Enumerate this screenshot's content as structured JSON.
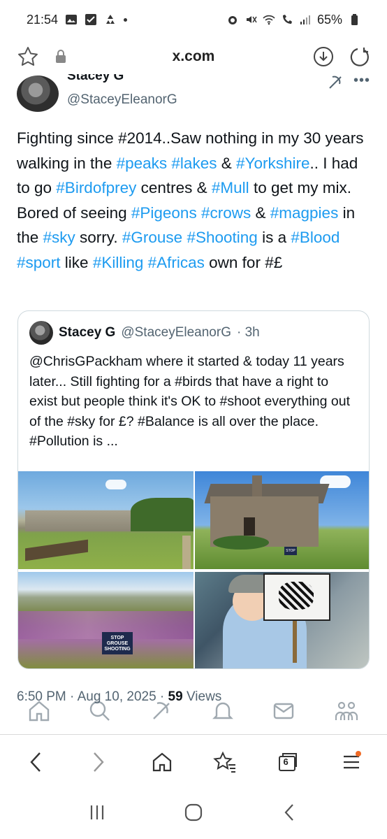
{
  "status_bar": {
    "time": "21:54",
    "battery": "65%"
  },
  "browser": {
    "url": "x.com"
  },
  "tweet": {
    "author_name": "Stacey G",
    "author_handle": "@StaceyEleanorG",
    "text_segments": [
      {
        "t": "Fighting since #2014..Saw nothing in my 30 years walking in the ",
        "tag": false
      },
      {
        "t": "#peaks",
        "tag": true
      },
      {
        "t": " ",
        "tag": false
      },
      {
        "t": "#lakes",
        "tag": true
      },
      {
        "t": " & ",
        "tag": false
      },
      {
        "t": "#Yorkshire",
        "tag": true
      },
      {
        "t": ".. I had to go ",
        "tag": false
      },
      {
        "t": "#Birdofprey",
        "tag": true
      },
      {
        "t": " centres & ",
        "tag": false
      },
      {
        "t": "#Mull",
        "tag": true
      },
      {
        "t": " to get my mix. Bored of seeing ",
        "tag": false
      },
      {
        "t": "#Pigeons",
        "tag": true
      },
      {
        "t": " ",
        "tag": false
      },
      {
        "t": "#crows",
        "tag": true
      },
      {
        "t": " & ",
        "tag": false
      },
      {
        "t": "#magpies",
        "tag": true
      },
      {
        "t": " in the ",
        "tag": false
      },
      {
        "t": "#sky",
        "tag": true
      },
      {
        "t": " sorry. ",
        "tag": false
      },
      {
        "t": "#Grouse",
        "tag": true
      },
      {
        "t": " ",
        "tag": false
      },
      {
        "t": "#Shooting",
        "tag": true
      },
      {
        "t": " is a ",
        "tag": false
      },
      {
        "t": "#Blood",
        "tag": true
      },
      {
        "t": " ",
        "tag": false
      },
      {
        "t": "#sport",
        "tag": true
      },
      {
        "t": " like ",
        "tag": false
      },
      {
        "t": "#Killing",
        "tag": true
      },
      {
        "t": " ",
        "tag": false
      },
      {
        "t": "#Africas",
        "tag": true
      },
      {
        "t": " own for #£",
        "tag": false
      }
    ],
    "timestamp": "6:50 PM · Aug 10, 2025 · ",
    "views_count": "59",
    "views_label": " Views"
  },
  "quote": {
    "author_name": "Stacey G",
    "author_handle": "@StaceyEleanorG",
    "age": "· 3h",
    "text": "@ChrisGPackham where it started & today 11 years later... Still fighting for a #birds that have a right to exist but people think it's OK to #shoot everything out of the #sky for £? #Balance is all over the place. #Pollution is ...",
    "photo3_sign": "STOP GROUSE SHOOTING",
    "photo2_sign": "STOP"
  },
  "browser_toolbar": {
    "tab_count": "6"
  },
  "colors": {
    "link": "#1d9bf0",
    "secondary_text": "#536471",
    "notification_dot": "#f06a25"
  }
}
